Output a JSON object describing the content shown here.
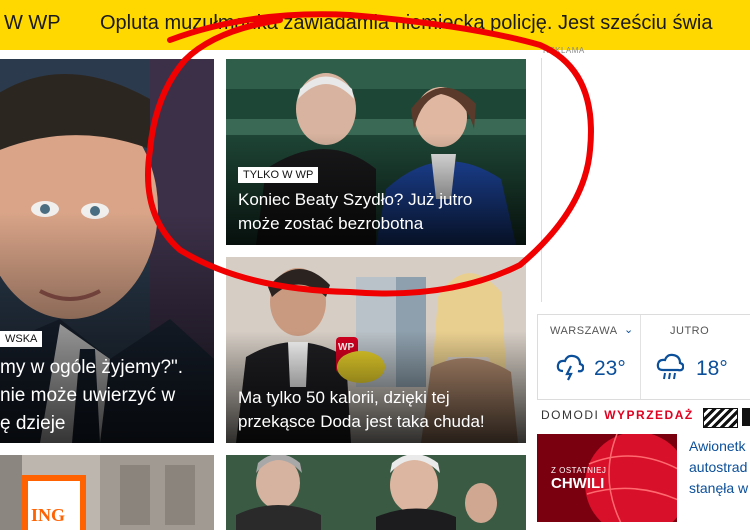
{
  "ticker": {
    "label": "W WP",
    "text": "Opluta muzułmanka zawiadamia niemiecką policję. Jest sześciu świa"
  },
  "cards": {
    "left_tag": "WSKA",
    "left_line1": "my w ogóle żyjemy?\".",
    "left_line2": "nie może uwierzyć w",
    "left_line3": "ę dzieje",
    "center_top_tag": "TYLKO W WP",
    "center_top_line1": "Koniec Beaty Szydło? Już jutro",
    "center_top_line2": "może zostać bezrobotna",
    "center_mid_line1": "Ma tylko 50 kalorii, dzięki tej",
    "center_mid_line2": "przekąsce Doda jest taka chuda!",
    "mic_logo": "WP",
    "bank_logo": "ING"
  },
  "ad": {
    "label": "REKLAMA"
  },
  "weather": {
    "city": "WARSZAWA",
    "today_temp": "23°",
    "tomorrow_label": "JUTRO",
    "tomorrow_temp": "18°"
  },
  "promo": {
    "prefix": "DOMODI",
    "highlight": "WYPRZEDAŻ"
  },
  "side_news": {
    "thumb_line1": "Z OSTATNIEJ",
    "thumb_line2": "CHWILI",
    "title_line1": "Awionetk",
    "title_line2": "autostrad",
    "title_line3": "stanęła w"
  },
  "colors": {
    "ticker_bg": "#ffd800",
    "annotation": "#f00000",
    "link": "#0b4f9a",
    "promo": "#e00020"
  }
}
